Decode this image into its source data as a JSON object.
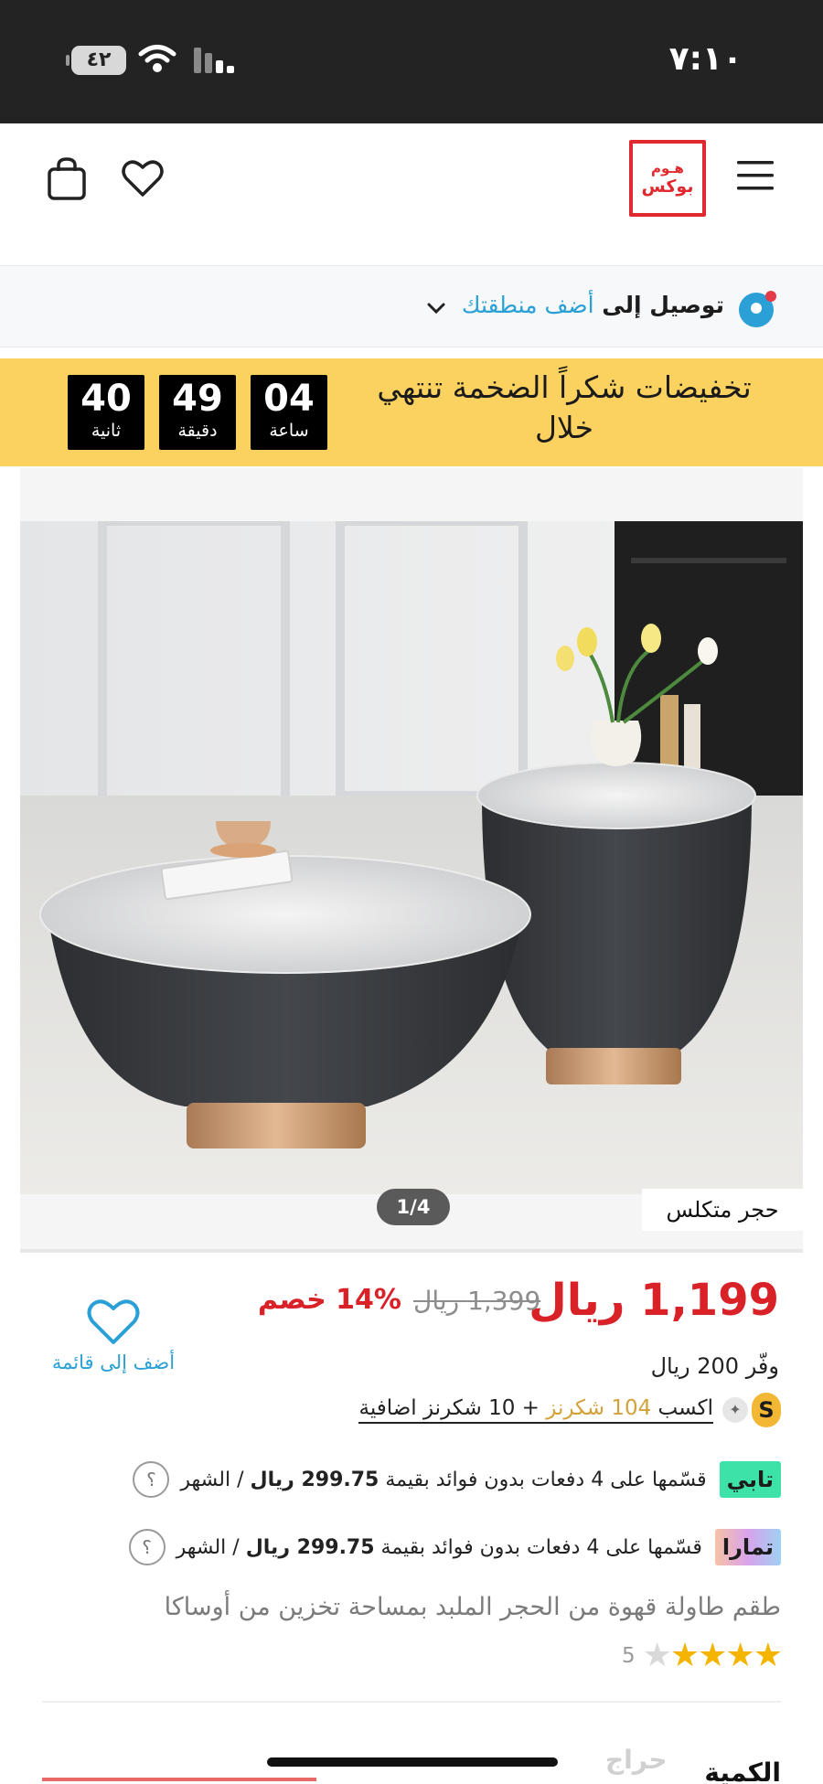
{
  "status_bar": {
    "time": "٧:١٠",
    "battery": "٤٢"
  },
  "header": {
    "logo_line1": "هـوم",
    "logo_line2": "بوكس"
  },
  "delivery": {
    "prefix": "توصيل إلى",
    "link": "أضف منطقتك"
  },
  "sale_banner": {
    "title": "تخفيضات شكراً الضخمة تنتهي خلال",
    "timer": [
      {
        "value": "04",
        "unit": "ساعة"
      },
      {
        "value": "49",
        "unit": "دقيقة"
      },
      {
        "value": "40",
        "unit": "ثانية"
      }
    ]
  },
  "gallery": {
    "counter": "1/4",
    "material_tag": "حجر متكلس"
  },
  "price": {
    "current": "1,199 ريال",
    "old": "1,399 ريال",
    "discount": "14% خصم",
    "savings": "وفّر 200 ريال"
  },
  "wishlist": {
    "label": "أضف إلى قائمة"
  },
  "points": {
    "badge": "S",
    "earn": "اكسب",
    "amount": "104 شكرنز",
    "bonus": "+ 10 شكرنز اضافية"
  },
  "installments": [
    {
      "provider": "تابي",
      "text": "قسّمها على 4 دفعات بدون فوائد بقيمة",
      "amount": "299.75 ريال",
      "suffix": "/ الشهر"
    },
    {
      "provider": "تمارا",
      "text": "قسّمها على 4 دفعات بدون فوائد بقيمة",
      "amount": "299.75 ريال",
      "suffix": "/ الشهر"
    }
  ],
  "product": {
    "title": "طقم طاولة قهوة من الحجر الملبد بمساحة تخزين من أوساكا",
    "rating": 4.5,
    "review_count": "5"
  },
  "quantity": {
    "label": "الكمية"
  },
  "watermark": "حراج",
  "colors": {
    "brand_red": "#e0282e",
    "price_red": "#d92128",
    "link_blue": "#2aa0d6",
    "banner_yellow": "#fbd160"
  }
}
